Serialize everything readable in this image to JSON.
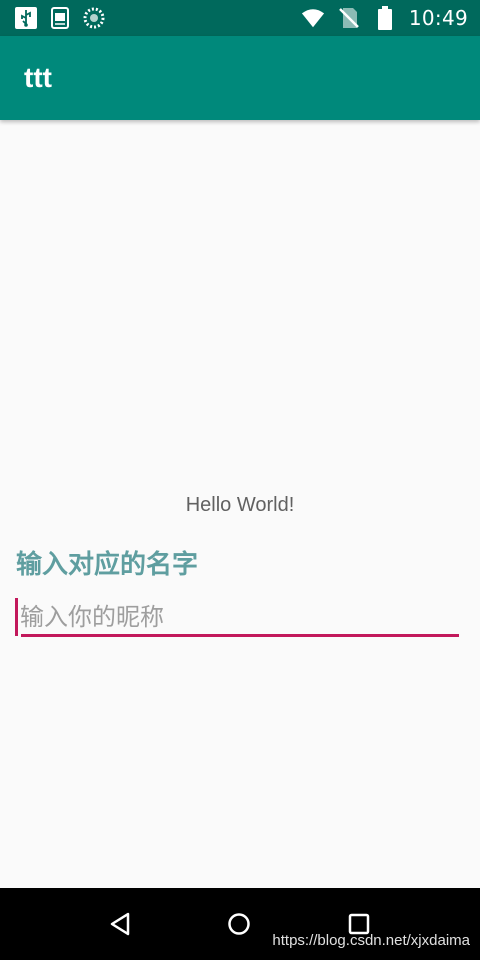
{
  "status_bar": {
    "time": "10:49",
    "left_icons": [
      "usb-icon",
      "clipboard-log-icon",
      "loading-circle-icon"
    ],
    "right_icons": [
      "wifi-icon",
      "no-sim-icon",
      "battery-icon"
    ]
  },
  "app_bar": {
    "title": "ttt"
  },
  "main": {
    "hello_text": "Hello World!",
    "name_label": "输入对应的名字",
    "nickname_input": {
      "value": "",
      "placeholder": "输入你的昵称"
    }
  },
  "colors": {
    "status_bar": "#00695c",
    "app_bar": "#00897b",
    "accent": "#c2185b",
    "label": "#5f9ea0"
  },
  "nav_bar": {
    "icons": [
      "back-icon",
      "home-icon",
      "recents-icon"
    ],
    "watermark": "https://blog.csdn.net/xjxdaima"
  }
}
